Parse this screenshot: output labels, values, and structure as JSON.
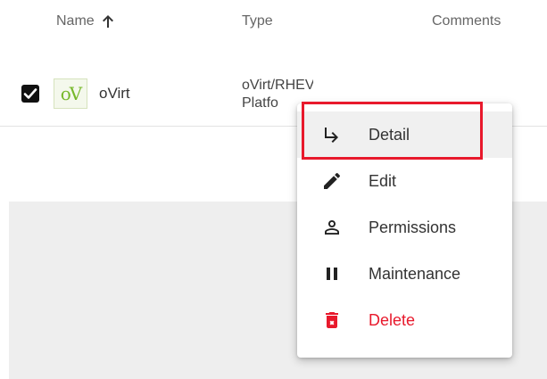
{
  "table": {
    "columns": {
      "name": "Name",
      "type": "Type",
      "comments": "Comments"
    },
    "sort_icon": "arrow-up-icon",
    "rows": [
      {
        "checked": true,
        "logo_text": "oV",
        "name": "oVirt",
        "type": "oVirt/RHEV Platfo"
      }
    ]
  },
  "context_menu": {
    "items": [
      {
        "label": "Detail",
        "icon": "subdirectory-arrow-icon"
      },
      {
        "label": "Edit",
        "icon": "pencil-icon"
      },
      {
        "label": "Permissions",
        "icon": "person-icon"
      },
      {
        "label": "Maintenance",
        "icon": "pause-icon"
      },
      {
        "label": "Delete",
        "icon": "trash-icon"
      }
    ]
  },
  "colors": {
    "delete": "#e8192c",
    "highlight_border": "#e8192c",
    "logo_green": "#76b82a"
  }
}
